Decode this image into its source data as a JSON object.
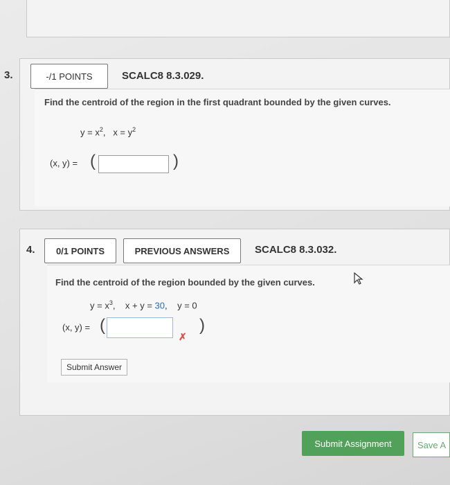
{
  "q3": {
    "number": "3.",
    "points": "-/1 POINTS",
    "code": "SCALC8 8.3.029.",
    "prompt": "Find the centroid of the region in the first quadrant bounded by the given curves.",
    "eq1": "y = x",
    "eq1_exp": "2",
    "eq_sep": ",",
    "eq2": "x = y",
    "eq2_exp": "2",
    "answer_label": "(x, y) =",
    "answer_value": ""
  },
  "q4": {
    "number": "4.",
    "points": "0/1 POINTS",
    "prev_answers": "PREVIOUS ANSWERS",
    "code": "SCALC8 8.3.032.",
    "prompt": "Find the centroid of the region bounded by the given curves.",
    "eq1": "y = x",
    "eq1_exp": "3",
    "eq2_prefix": "x + y = ",
    "eq2_value": "30",
    "eq3": "y = 0",
    "answer_label": "(x, y) =",
    "answer_value": "",
    "incorrect_mark": "✗",
    "submit_answer": "Submit Answer"
  },
  "footer": {
    "submit_assignment": "Submit Assignment",
    "save": "Save A"
  },
  "colors": {
    "accent_green": "#52a15a",
    "incorrect_red": "#d9534f",
    "value_blue": "#2a6db5"
  }
}
